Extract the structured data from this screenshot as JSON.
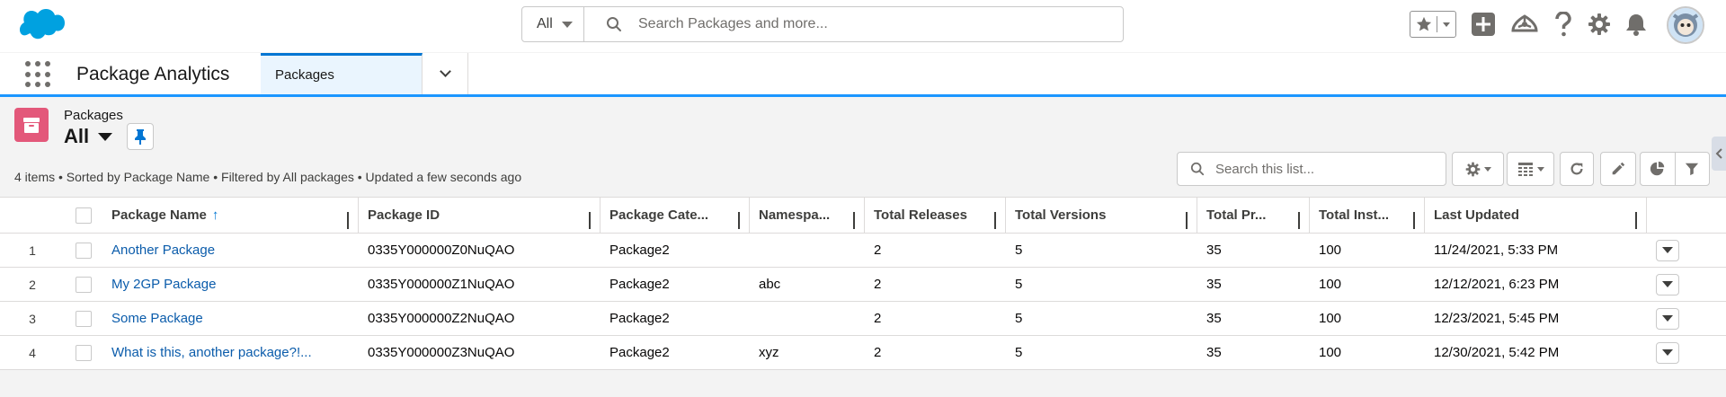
{
  "header": {
    "search_scope": "All",
    "search_placeholder": "Search Packages and more..."
  },
  "app_nav": {
    "app_name": "Package Analytics",
    "tab_label": "Packages"
  },
  "list_view": {
    "object_label": "Packages",
    "view_name": "All",
    "meta": "4 items • Sorted by Package Name • Filtered by All packages • Updated a few seconds ago",
    "search_placeholder": "Search this list..."
  },
  "table": {
    "columns": [
      "Package Name",
      "Package ID",
      "Package Cate...",
      "Namespa...",
      "Total Releases",
      "Total Versions",
      "Total Pr...",
      "Total Inst...",
      "Last Updated"
    ],
    "sort_indicator": "↑",
    "rows": [
      {
        "num": "1",
        "name": "Another Package",
        "id": "0335Y000000Z0NuQAO",
        "category": "Package2",
        "namespace": "",
        "releases": "2",
        "versions": "5",
        "total_pr": "35",
        "total_inst": "100",
        "updated": "11/24/2021, 5:33 PM"
      },
      {
        "num": "2",
        "name": "My 2GP Package",
        "id": "0335Y000000Z1NuQAO",
        "category": "Package2",
        "namespace": "abc",
        "releases": "2",
        "versions": "5",
        "total_pr": "35",
        "total_inst": "100",
        "updated": "12/12/2021, 6:23 PM"
      },
      {
        "num": "3",
        "name": "Some Package",
        "id": "0335Y000000Z2NuQAO",
        "category": "Package2",
        "namespace": "",
        "releases": "2",
        "versions": "5",
        "total_pr": "35",
        "total_inst": "100",
        "updated": "12/23/2021, 5:45 PM"
      },
      {
        "num": "4",
        "name": "What is this, another package?!...",
        "id": "0335Y000000Z3NuQAO",
        "category": "Package2",
        "namespace": "xyz",
        "releases": "2",
        "versions": "5",
        "total_pr": "35",
        "total_inst": "100",
        "updated": "12/30/2021, 5:42 PM"
      }
    ]
  },
  "colors": {
    "brand_blue": "#1b96ff",
    "link": "#0b5cab",
    "object_icon": "#e3587a"
  }
}
